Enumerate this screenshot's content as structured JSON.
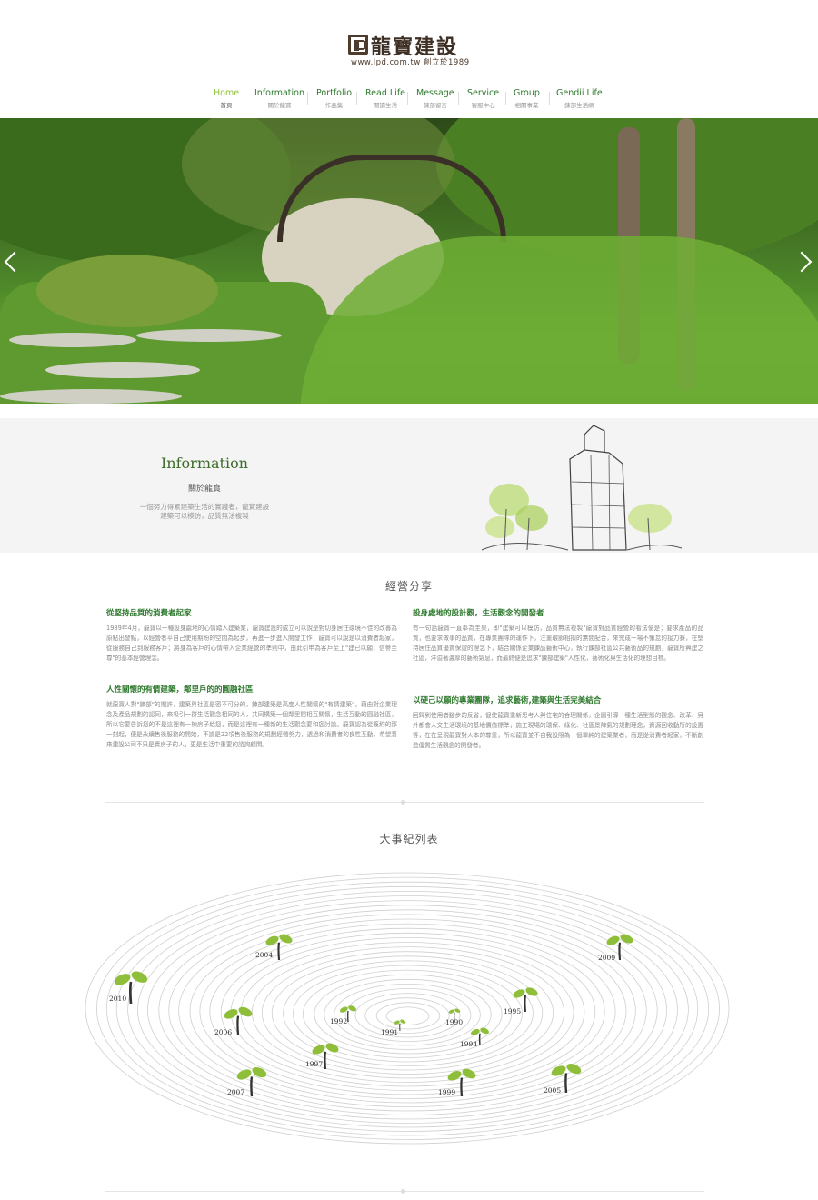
{
  "header": {
    "brand_name": "龍寶建設",
    "brand_sub": "www.lpd.com.tw 創立於1989"
  },
  "nav": [
    {
      "en": "Home",
      "zh": "首頁",
      "active": true
    },
    {
      "en": "Information",
      "zh": "關於龍寶"
    },
    {
      "en": "Portfolio",
      "zh": "作品集"
    },
    {
      "en": "Read Life",
      "zh": "閱讀生活"
    },
    {
      "en": "Message",
      "zh": "鍊部留言"
    },
    {
      "en": "Service",
      "zh": "客服中心"
    },
    {
      "en": "Group",
      "zh": "相關事業"
    },
    {
      "en": "Gendii Life",
      "zh": "鍊部生活網"
    }
  ],
  "info": {
    "title": "Information",
    "subtitle": "關於龍寶",
    "desc_line1": "一個努力得累建築生活的實踐者，龍寶建設",
    "desc_line2": "建築可以模仿，品質無法複製"
  },
  "business": {
    "title": "經營分享",
    "articles": [
      {
        "title": "從堅持品質的消費者起家",
        "body": "1989年4月，龍寶以一種設身處地的心情踏入建築業，龍寶建設的成立可以說是對切身居住環境不佳的改善為原點出發點，以經營者平自己使用期盼的空間為起步，再進一步進入開發工作，龍寶可以說是以消費者起家，從服務自己到服務客戶；將身為客戶的心情帶入企業經營的準則中，由此引申為客戶至上\"建已以願，信譽至尊\"的基本經營理念。"
      },
      {
        "title": "人性關懷的有情建築，鄰里戶的的圓融社區",
        "body": "就龍寶人對\"鍊部\"的期許，建築與社區是密不可分的，鍊部建築是高度人性關懷的\"有情建築\"，藉由對企業理念及產品規劃的認同，來吸引一群生活觀念相同的人，共同構築一個鄰里間相互關懷，生活互動的圓融社區，所以它要告訴您的不是這裡有一棟房子給您，而是這裡有一種新的生活觀念要和您討論。龍寶認為從簽約的那一刻起，便是永續售後服務的開始，不論是22項售後服務的規劃經營努力，透過和消費者的良性互動，希望將來建設公司不只是賣房子的人，更是生活中重要的諮詢顧問。"
      },
      {
        "title": "設身處地的設計觀，生活觀念的開發者",
        "body": "有一句話龍寶一直奉為圭臬，即\"建築可以模仿，品質無法複製\"龍寶對品質經營的看法便是；要求產品的品質，也要求做事的品質，在專業團隊的運作下，注重環節相扣的無間配合，來完成一場不懈怠的接力賽，在堅持居住品質優質保證的理念下，結合關係企業鍊品藝術中心，執行鍊部社區公共藝術品的規劃，龍寶所興建之社區，洋溢著濃厚的藝術氣息，而最終便是追求\"鍊部建築\"人性化，藝術化與生活化的理想目標。"
      },
      {
        "title": "以硬己以願的專業團隊，追求藝術,建築與生活完美結合",
        "body": "回歸到使用者腳步的反省，促使龍寶重新思考人與住宅的合理關係，企圖引導一種生活型態的觀念、改革、另外都會人文生活環境的基地價值標準，施工現場的環保、綠化、社區景陣氣的規劃理念，資源回收動所的設置等，在在呈現龍寶對人本的尊重，所以龍寶並不自我設限為一個單純的建築業者，而是從消費者起家，不斷創造優質生活觀念的開發者。"
      }
    ]
  },
  "timeline": {
    "title": "大事紀列表",
    "years": [
      "1990",
      "1991",
      "1992",
      "1994",
      "1995",
      "1997",
      "1999",
      "2004",
      "2005",
      "2006",
      "2007",
      "2009",
      "2010"
    ]
  },
  "colors": {
    "brand_green": "#2f7a2f",
    "active_green": "#8fc23a",
    "brand_brown": "#3d2f24"
  }
}
